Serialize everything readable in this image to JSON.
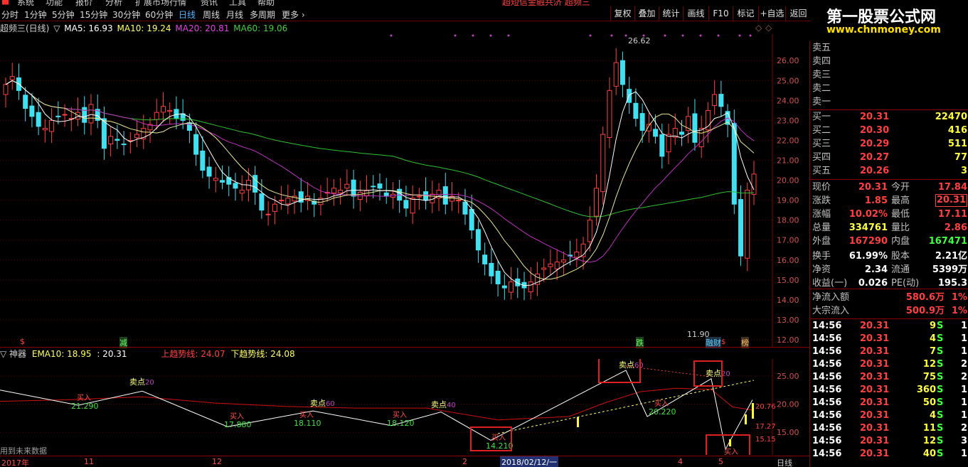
{
  "menu": [
    "系统",
    "功能",
    "报价",
    "分析",
    "扩展市场行情",
    "资讯",
    "工具",
    "帮助"
  ],
  "title_marquee": "超短信金融共济 超频三",
  "toolbar": {
    "periods": [
      {
        "label": "分时"
      },
      {
        "label": "1分钟"
      },
      {
        "label": "5分钟"
      },
      {
        "label": "15分钟"
      },
      {
        "label": "30分钟"
      },
      {
        "label": "60分钟"
      },
      {
        "label": "日线",
        "active": true
      },
      {
        "label": "周线"
      },
      {
        "label": "月线"
      },
      {
        "label": "多周期"
      },
      {
        "label": "更多 ›"
      }
    ],
    "buttons": [
      "复权",
      "叠加",
      "统计",
      "画线",
      "F10",
      "标记",
      "+自选",
      "返回"
    ]
  },
  "logo": {
    "title": "第一股票公式网",
    "url": "www.chnmoney.com"
  },
  "main_info": {
    "name": "超频三(日线)",
    "marker": "▽",
    "ma5": "MA5: 16.93",
    "ma10": "MA10: 19.24",
    "ma20": "MA20: 20.81",
    "ma60": "MA60: 19.06"
  },
  "price_axis": [
    "26.00",
    "25.00",
    "24.00",
    "23.00",
    "22.00",
    "21.00",
    "20.00",
    "19.00",
    "18.00",
    "17.00",
    "16.00",
    "15.00",
    "14.00",
    "13.00",
    "12.00"
  ],
  "main_labels": {
    "high": "26.62",
    "low": "11.90"
  },
  "event_markers": [
    "$",
    "减",
    "跌",
    "融财",
    "$",
    "榜"
  ],
  "sub_info": {
    "name": "▽ 神器",
    "ema": "EMA10: 18.95",
    "val": ": 20.31",
    "up": "上趋势线: 24.07",
    "down": "下趋势线: 24.08"
  },
  "sub_axis": [
    "25.00",
    "20.00",
    "15.00"
  ],
  "sub_labels": {
    "sell": "卖点",
    "buy": "买入",
    "sell_vals": [
      "20",
      "60",
      "40",
      "60",
      "20",
      "60"
    ],
    "buy_vals": [
      "21.290",
      "17.880",
      "18.110",
      "18.120",
      "14.210",
      "20.220"
    ],
    "right_vals": [
      "20.76",
      "17.27",
      "15.15"
    ]
  },
  "footer_note": "用到未来数据",
  "x_axis": {
    "labels": [
      "2017年",
      "11",
      "12",
      "2",
      "2018/02/12/一",
      "4",
      "5"
    ],
    "tab": "日线"
  },
  "quote": {
    "asks": [
      "卖五",
      "卖四",
      "卖三",
      "卖二",
      "卖一"
    ],
    "bids": [
      {
        "label": "买一",
        "price": "20.31",
        "vol": "22470"
      },
      {
        "label": "买二",
        "price": "20.30",
        "vol": "416"
      },
      {
        "label": "买三",
        "price": "20.29",
        "vol": "511"
      },
      {
        "label": "买四",
        "price": "20.27",
        "vol": "77"
      },
      {
        "label": "买五",
        "price": "20.26",
        "vol": "3"
      }
    ],
    "stats": [
      {
        "l1": "现价",
        "v1": "20.31",
        "l2": "今开",
        "v2": "17.84"
      },
      {
        "l1": "涨跌",
        "v1": "1.85",
        "l2": "最高",
        "v2": "20.31"
      },
      {
        "l1": "涨幅",
        "v1": "10.02%",
        "l2": "最低",
        "v2": "17.11"
      },
      {
        "l1": "总量",
        "v1": "334761",
        "l2": "量比",
        "v2": "2.86"
      },
      {
        "l1": "外盘",
        "v1": "167290",
        "l2": "内盘",
        "v2": "167471"
      },
      {
        "l1": "换手",
        "v1": "61.99%",
        "l2": "股本",
        "v2": "2.21亿"
      },
      {
        "l1": "净资",
        "v1": "2.34",
        "l2": "流通",
        "v2": "5399万"
      },
      {
        "l1": "收益(一)",
        "v1": "0.026",
        "l2": "PE(动)",
        "v2": "195.3"
      }
    ],
    "flow": [
      {
        "label": "净流入额",
        "val": "580.6万",
        "pct": "1%"
      },
      {
        "label": "大宗流入",
        "val": "500.9万",
        "pct": "1%"
      }
    ],
    "ticks": [
      {
        "t": "14:56",
        "p": "20.31",
        "v": "9",
        "s": "S",
        "n": "1"
      },
      {
        "t": "14:56",
        "p": "20.31",
        "v": "4",
        "s": "S",
        "n": "1"
      },
      {
        "t": "14:56",
        "p": "20.31",
        "v": "7",
        "s": "S",
        "n": "1"
      },
      {
        "t": "14:56",
        "p": "20.31",
        "v": "12",
        "s": "S",
        "n": "2"
      },
      {
        "t": "14:56",
        "p": "20.31",
        "v": "75",
        "s": "S",
        "n": "2"
      },
      {
        "t": "14:56",
        "p": "20.31",
        "v": "360",
        "s": "S",
        "n": "1"
      },
      {
        "t": "14:56",
        "p": "20.31",
        "v": "50",
        "s": "S",
        "n": "1"
      },
      {
        "t": "14:56",
        "p": "20.31",
        "v": "4",
        "s": "S",
        "n": "1"
      },
      {
        "t": "14:56",
        "p": "20.31",
        "v": "11",
        "s": "S",
        "n": "2"
      },
      {
        "t": "14:56",
        "p": "20.31",
        "v": "12",
        "s": "S",
        "n": "3"
      },
      {
        "t": "14:56",
        "p": "20.31",
        "v": "40",
        "s": "S",
        "n": "1"
      }
    ]
  }
}
